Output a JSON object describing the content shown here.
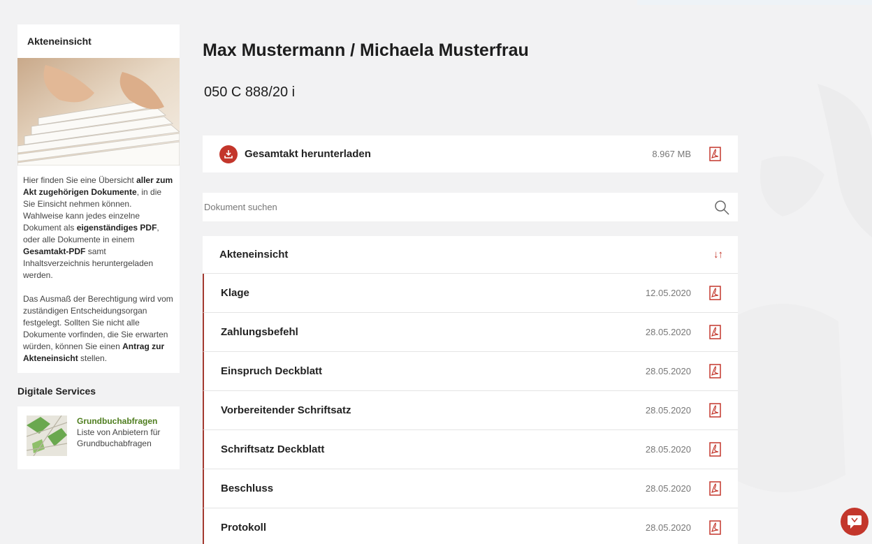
{
  "sidebar": {
    "info_title": "Akteneinsicht",
    "info_text": {
      "p1_a": "Hier finden Sie eine Übersicht ",
      "p1_b": "aller zum Akt zugehörigen Dokumente",
      "p1_c": ", in die Sie Einsicht nehmen können. Wahlweise kann jedes einzelne Dokument als ",
      "p1_d": "eigenständiges PDF",
      "p1_e": ", oder alle Dokumente in einem ",
      "p1_f": "Gesamtakt-PDF",
      "p1_g": " samt Inhaltsverzeichnis heruntergeladen werden.",
      "p2_a": "Das Ausmaß der Berechtigung wird vom zuständigen Entscheidungsorgan festgelegt. Sollten Sie nicht alle Dokumente vorfinden, die Sie erwarten würden, können Sie einen ",
      "p2_b": "Antrag zur Akteneinsicht",
      "p2_c": " stellen."
    },
    "services_title": "Digitale Services",
    "service": {
      "link": "Grundbuchabfragen",
      "description": "Liste von Anbietern für Grundbuchabfragen"
    }
  },
  "main": {
    "case_title": "Max Mustermann / Michaela Musterfrau",
    "case_number": "050 C 888/20 i",
    "download": {
      "label": "Gesamtakt herunterladen",
      "size": "8.967 MB"
    },
    "search": {
      "placeholder": "Dokument suchen"
    },
    "list": {
      "header": "Akteneinsicht",
      "sort_icon": "↓↑",
      "documents": [
        {
          "name": "Klage",
          "date": "12.05.2020"
        },
        {
          "name": "Zahlungsbefehl",
          "date": "28.05.2020"
        },
        {
          "name": "Einspruch Deckblatt",
          "date": "28.05.2020"
        },
        {
          "name": "Vorbereitender Schriftsatz",
          "date": "28.05.2020"
        },
        {
          "name": "Schriftsatz Deckblatt",
          "date": "28.05.2020"
        },
        {
          "name": "Beschluss",
          "date": "28.05.2020"
        },
        {
          "name": "Protokoll",
          "date": "28.05.2020"
        }
      ]
    }
  },
  "colors": {
    "accent": "#c3362b",
    "row_border": "#a33a30",
    "service_link": "#4e7d1e"
  },
  "icons": {
    "download": "download-icon",
    "pdf": "pdf-icon",
    "search": "search-icon",
    "sort": "sort-icon",
    "chat": "chat-icon"
  }
}
